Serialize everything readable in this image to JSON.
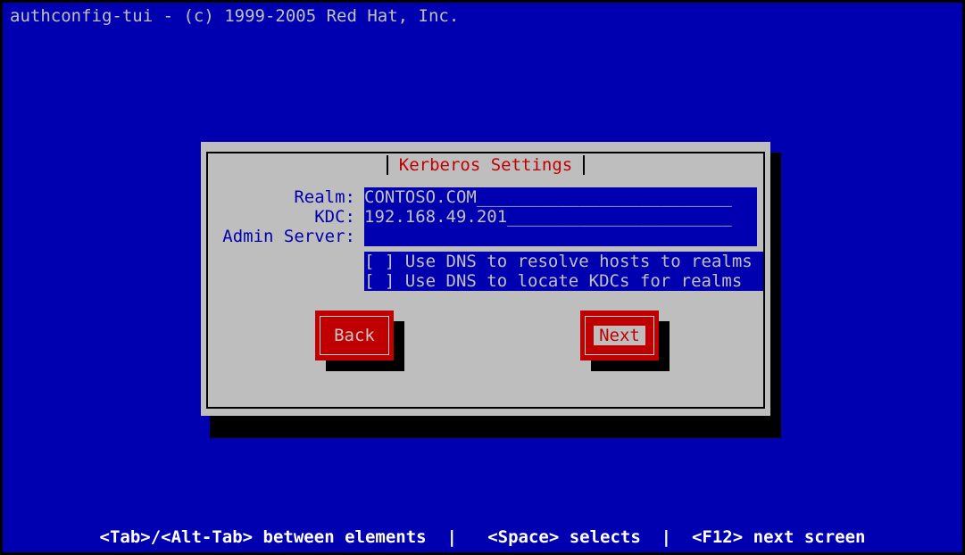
{
  "header": {
    "app_title": "authconfig-tui - (c) 1999-2005 Red Hat, Inc."
  },
  "dialog": {
    "title": "Kerberos Settings",
    "fields": [
      {
        "label": "Realm:",
        "value": "CONTOSO.COM",
        "filler": "_________________________"
      },
      {
        "label": "KDC:",
        "value": "192.168.49.201",
        "filler": "______________________"
      },
      {
        "label": "Admin Server:",
        "value": "",
        "filler": ""
      }
    ],
    "checkboxes": [
      {
        "mark": "[ ]",
        "label": "Use DNS to resolve hosts to realms",
        "checked": false
      },
      {
        "mark": "[ ]",
        "label": "Use DNS to locate KDCs for realms",
        "checked": false
      }
    ],
    "buttons": [
      {
        "label": "Back",
        "focused": false
      },
      {
        "label": "Next",
        "focused": true
      }
    ]
  },
  "statusbar": {
    "text": "<Tab>/<Alt-Tab> between elements  |   <Space> selects  |  <F12> next screen"
  },
  "colors": {
    "screen_background": "#0000b0",
    "dialog_background": "#bebebe",
    "title_accent": "#c00000",
    "text_light": "#c0c0c0",
    "label_blue": "#0000b0",
    "button_red": "#c00000",
    "shadow": "#000000"
  }
}
